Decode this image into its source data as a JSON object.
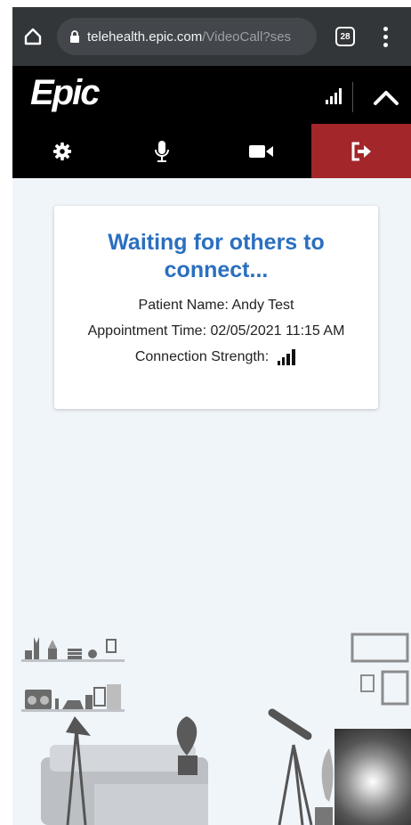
{
  "browser": {
    "url_host": "telehealth.epic.com",
    "url_path": "/VideoCall?ses",
    "tab_count": "28"
  },
  "header": {
    "logo_text": "Epic"
  },
  "controls": [
    {
      "name": "settings",
      "icon": "gear-icon"
    },
    {
      "name": "microphone",
      "icon": "microphone-icon"
    },
    {
      "name": "camera",
      "icon": "video-camera-icon"
    },
    {
      "name": "leave",
      "icon": "exit-icon",
      "color": "#a3262a"
    }
  ],
  "card": {
    "title": "Waiting for others to connect...",
    "patient_name": "Patient Name: Andy Test",
    "appointment_time": "Appointment Time: 02/05/2021 11:15 AM",
    "connection_label": "Connection Strength:"
  },
  "colors": {
    "title_blue": "#2a6fc0",
    "leave_red": "#a3262a",
    "background": "#f0f5fa"
  }
}
